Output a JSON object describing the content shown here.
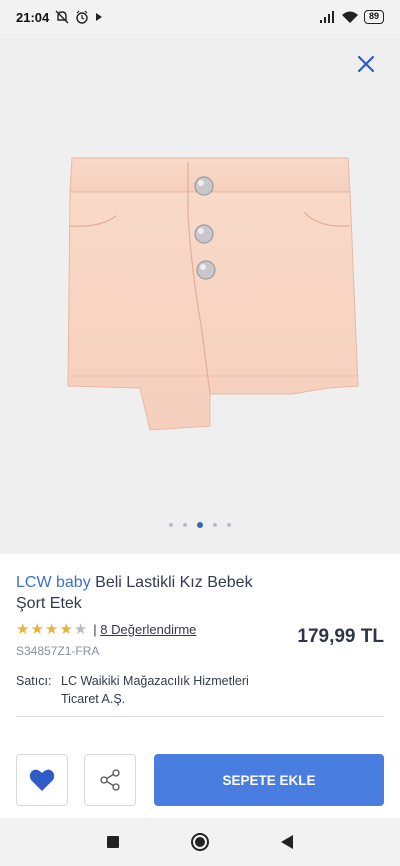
{
  "status_bar": {
    "time": "21:04",
    "battery": "89",
    "icons": [
      "do-not-disturb-off-icon",
      "alarm-icon",
      "play-icon",
      "signal-icon",
      "wifi-icon",
      "battery-icon"
    ]
  },
  "gallery": {
    "close_icon": "close-icon",
    "image_count": 5,
    "active_index": 2
  },
  "product": {
    "brand": "LCW baby",
    "name": "Beli Lastikli Kız Bebek Şort Etek",
    "rating": 4.5,
    "reviews_label": "8 Değerlendirme",
    "reviews_separator": "|",
    "price": "179,99 TL",
    "sku": "S34857Z1-FRA",
    "seller_label": "Satıcı:",
    "seller_name": "LC Waikiki Mağazacılık Hizmetleri Ticaret A.Ş."
  },
  "actions": {
    "favorite_icon": "heart-icon",
    "share_icon": "share-icon",
    "add_to_cart_label": "SEPETE EKLE"
  },
  "nav_bar": {
    "icons": [
      "recents-icon",
      "home-icon",
      "back-icon"
    ]
  },
  "colors": {
    "accent": "#4a7de0",
    "brand": "#3d6fcf",
    "heart": "#2e5bc7",
    "star": "#e7b33c"
  }
}
